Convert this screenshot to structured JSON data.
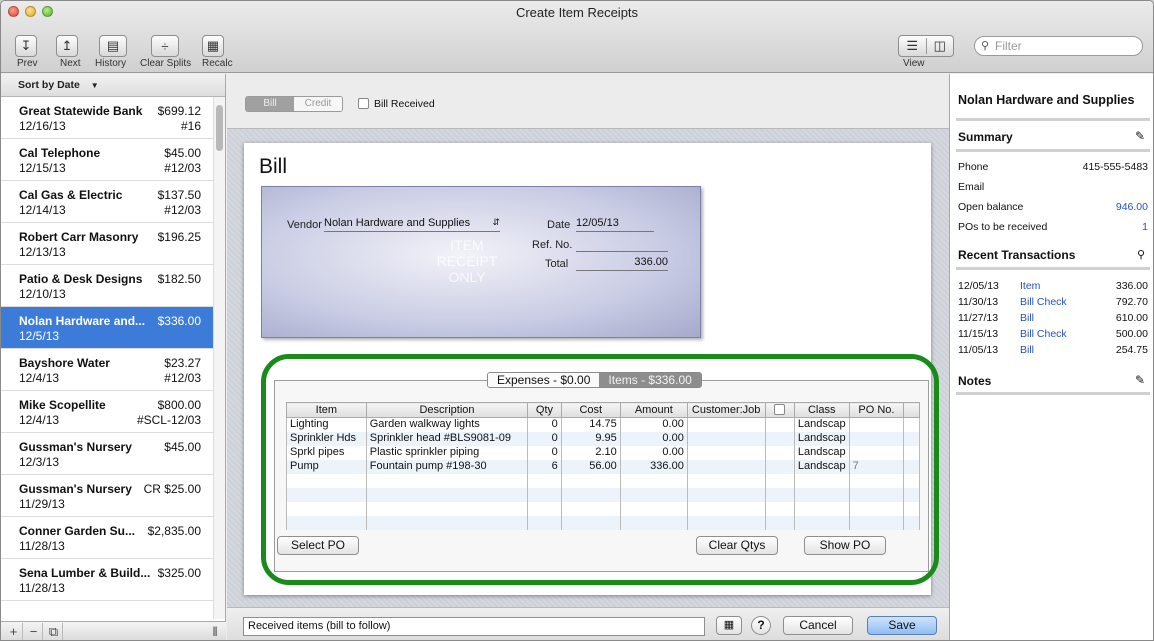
{
  "window": {
    "title": "Create Item Receipts"
  },
  "toolbar": {
    "buttons": [
      {
        "label": "Prev",
        "icon": "arrow-down-icon"
      },
      {
        "label": "Next",
        "icon": "arrow-up-icon"
      },
      {
        "label": "History",
        "icon": "history-icon"
      },
      {
        "label": "Clear Splits",
        "icon": "clear-splits-icon"
      },
      {
        "label": "Recalc",
        "icon": "calculator-icon"
      }
    ],
    "view_label": "View",
    "filter_placeholder": "Filter"
  },
  "sidebar": {
    "sort_label": "Sort by Date",
    "items": [
      {
        "name": "Great Statewide Bank",
        "amount": "$699.12",
        "date": "12/16/13",
        "ref": "#16"
      },
      {
        "name": "Cal Telephone",
        "amount": "$45.00",
        "date": "12/15/13",
        "ref": "#12/03"
      },
      {
        "name": "Cal Gas & Electric",
        "amount": "$137.50",
        "date": "12/14/13",
        "ref": "#12/03"
      },
      {
        "name": "Robert Carr Masonry",
        "amount": "$196.25",
        "date": "12/13/13",
        "ref": ""
      },
      {
        "name": "Patio & Desk Designs",
        "amount": "$182.50",
        "date": "12/10/13",
        "ref": ""
      },
      {
        "name": "Nolan Hardware and...",
        "amount": "$336.00",
        "date": "12/5/13",
        "ref": "",
        "selected": true
      },
      {
        "name": "Bayshore Water",
        "amount": "$23.27",
        "date": "12/4/13",
        "ref": "#12/03"
      },
      {
        "name": "Mike Scopellite",
        "amount": "$800.00",
        "date": "12/4/13",
        "ref": "#SCL-12/03"
      },
      {
        "name": "Gussman's Nursery",
        "amount": "$45.00",
        "date": "12/3/13",
        "ref": ""
      },
      {
        "name": "Gussman's Nursery",
        "amount": "CR $25.00",
        "date": "11/29/13",
        "ref": ""
      },
      {
        "name": "Conner Garden Su...",
        "amount": "$2,835.00",
        "date": "11/28/13",
        "ref": ""
      },
      {
        "name": "Sena Lumber & Build...",
        "amount": "$325.00",
        "date": "11/28/13",
        "ref": ""
      }
    ]
  },
  "header": {
    "seg_bill": "Bill",
    "seg_credit": "Credit",
    "bill_received": "Bill Received"
  },
  "form": {
    "title": "Bill",
    "vendor_label": "Vendor",
    "vendor_value": "Nolan Hardware and Supplies",
    "date_label": "Date",
    "date_value": "12/05/13",
    "ref_label": "Ref. No.",
    "ref_value": "",
    "total_label": "Total",
    "total_value": "336.00",
    "watermark": [
      "ITEM",
      "RECEIPT",
      "ONLY"
    ]
  },
  "tabs": {
    "expenses": "Expenses - $0.00",
    "items": "Items - $336.00"
  },
  "grid": {
    "columns": [
      "Item",
      "Description",
      "Qty",
      "Cost",
      "Amount",
      "Customer:Job",
      "",
      "Class",
      "PO No."
    ],
    "rows": [
      {
        "item": "Lighting",
        "desc": "Garden walkway lights",
        "qty": "0",
        "cost": "14.75",
        "amount": "0.00",
        "job": "",
        "cls": "Landscap",
        "po": ""
      },
      {
        "item": "Sprinkler Hds",
        "desc": "Sprinkler head #BLS9081-09",
        "qty": "0",
        "cost": "9.95",
        "amount": "0.00",
        "job": "",
        "cls": "Landscap",
        "po": ""
      },
      {
        "item": "Sprkl pipes",
        "desc": "Plastic sprinkler piping",
        "qty": "0",
        "cost": "2.10",
        "amount": "0.00",
        "job": "",
        "cls": "Landscap",
        "po": ""
      },
      {
        "item": "Pump",
        "desc": "Fountain pump #198-30",
        "qty": "6",
        "cost": "56.00",
        "amount": "336.00",
        "job": "",
        "cls": "Landscap",
        "po": "7"
      }
    ]
  },
  "grid_buttons": {
    "select_po": "Select PO",
    "clear_qtys": "Clear Qtys",
    "show_po": "Show PO"
  },
  "bottom": {
    "memo": "Received items (bill to follow)",
    "cancel": "Cancel",
    "save": "Save",
    "help": "?"
  },
  "info": {
    "vendor": "Nolan Hardware and Supplies",
    "summary_title": "Summary",
    "phone_label": "Phone",
    "phone": "415-555-5483",
    "email_label": "Email",
    "email": "",
    "open_label": "Open balance",
    "open": "946.00",
    "pos_label": "POs to be received",
    "pos": "1",
    "recent_title": "Recent Transactions",
    "recent": [
      {
        "date": "12/05/13",
        "type": "Item",
        "amount": "336.00"
      },
      {
        "date": "11/30/13",
        "type": "Bill Check",
        "amount": "792.70"
      },
      {
        "date": "11/27/13",
        "type": "Bill",
        "amount": "610.00"
      },
      {
        "date": "11/15/13",
        "type": "Bill Check",
        "amount": "500.00"
      },
      {
        "date": "11/05/13",
        "type": "Bill",
        "amount": "254.75"
      }
    ],
    "notes_title": "Notes"
  },
  "colors": {
    "selection": "#3d7bd8",
    "highlight": "#1a8a1a",
    "link": "#2650c8"
  }
}
